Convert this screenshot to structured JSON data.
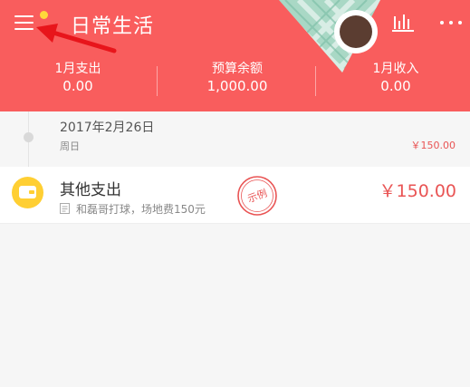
{
  "header": {
    "title": "日常生活",
    "background_color": "#f95d5d",
    "menu_icon": "menu-icon",
    "notification_dot_color": "#ffd93a",
    "chart_icon": "bar-chart-icon",
    "more_icon": "more-dots-icon"
  },
  "summary": {
    "expense": {
      "label": "1月支出",
      "value": "0.00"
    },
    "budget": {
      "label": "预算余额",
      "value": "1,000.00"
    },
    "income": {
      "label": "1月收入",
      "value": "0.00"
    }
  },
  "day_group": {
    "date": "2017年2月26日",
    "weekday": "周日",
    "total": "￥150.00"
  },
  "record": {
    "category": "其他支出",
    "category_icon": "wallet-icon",
    "category_color": "#ffcf33",
    "note": "和磊哥打球，场地费150元",
    "stamp": "示例",
    "amount": "￥150.00",
    "amount_color": "#e95454"
  },
  "annotation": {
    "arrow_color": "#e8151b"
  }
}
